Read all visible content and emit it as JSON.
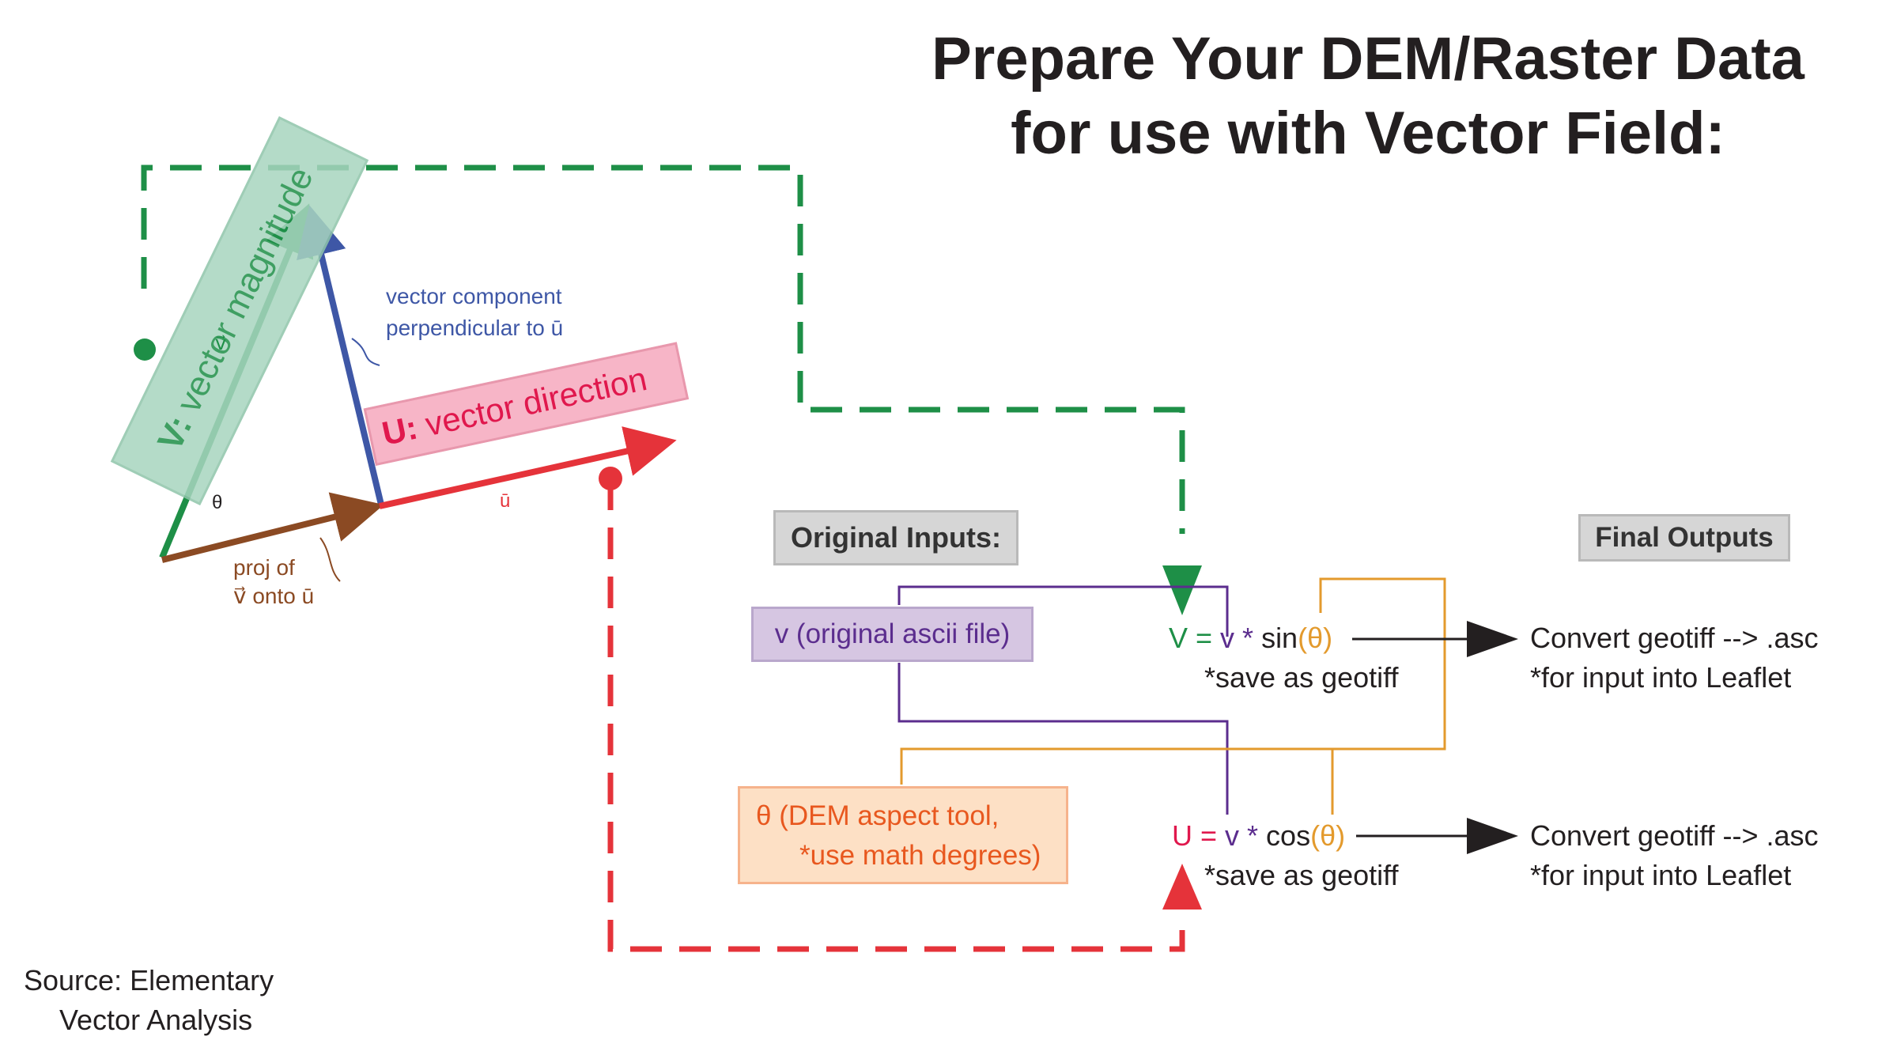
{
  "title": {
    "line1": "Prepare Your DEM/Raster Data",
    "line2": "for use with Vector Field:"
  },
  "source": {
    "line1": "Source: Elementary",
    "line2": "Vector Analysis"
  },
  "vector_figure": {
    "v_magnitude_prefix": "V:",
    "v_magnitude_text": " vector magnitude",
    "u_direction_prefix": "U:",
    "u_direction_text": " vector direction",
    "perp_line1": "vector component",
    "perp_line2": "perpendicular to ū",
    "proj_line1": "proj of",
    "proj_line2": "v⃗ onto ū",
    "v_symbol": "v⃗",
    "u_symbol": "ū",
    "theta_symbol": "θ"
  },
  "boxes": {
    "original_inputs": "Original Inputs:",
    "final_outputs": "Final Outputs",
    "v_input": "v (original ascii file)",
    "theta_line1": "θ (DEM aspect tool,",
    "theta_line2": "*use math degrees)"
  },
  "formulas": {
    "V": {
      "lhs": "V",
      "eq": " = ",
      "v": "v",
      "star": " * ",
      "fn": "sin",
      "open": "(",
      "theta": "θ",
      "close": ")",
      "note": "*save as geotiff"
    },
    "U": {
      "lhs": "U",
      "eq": " = ",
      "v": "v",
      "star": " * ",
      "fn": "cos",
      "open": "(",
      "theta": "θ",
      "close": ")",
      "note": "*save as geotiff"
    }
  },
  "outputs": {
    "top_line1": "Convert geotiff --> .asc",
    "top_line2": "*for input into Leaflet",
    "bottom_line1": "Convert geotiff --> .asc",
    "bottom_line2": "*for input into Leaflet"
  },
  "colors": {
    "green": "#1e8f47",
    "red": "#e5333a",
    "purple": "#5b2d8e",
    "orange": "#e39a2d",
    "blue": "#3e57a6",
    "brown": "#8b4a23",
    "pink": "#e0184d"
  }
}
